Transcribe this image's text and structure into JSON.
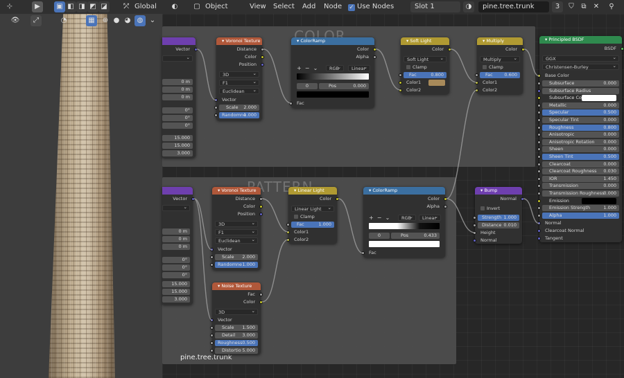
{
  "header": {
    "transform_orientation": "Global",
    "editor_type": "Object",
    "menu": [
      "View",
      "Select",
      "Add",
      "Node"
    ],
    "use_nodes_label": "Use Nodes",
    "use_nodes": true,
    "slot": "Slot 1",
    "material_name": "pine.tree.trunk",
    "user_count": "3"
  },
  "frames": {
    "color": "COLOR",
    "pattern": "PATTERN",
    "footer": "pine.tree.trunk"
  },
  "left_partial": {
    "top": {
      "vector": "Vector",
      "values": [
        "0 m",
        "0 m",
        "0 m",
        "0°",
        "0°",
        "0°",
        "15.000",
        "15.000",
        "3.000"
      ]
    },
    "bottom": {
      "vector": "Vector",
      "values": [
        "0 m",
        "0 m",
        "0 m",
        "0°",
        "0°",
        "0°",
        "15.000",
        "15.000",
        "3.000"
      ]
    }
  },
  "voronoi1": {
    "title": "Voronoi Texture",
    "out": [
      "Distance",
      "Color",
      "Position"
    ],
    "dims": "3D",
    "feature": "F1",
    "metric": "Euclidean",
    "vector": "Vector",
    "scale_label": "Scale",
    "scale": "2.000",
    "rand_label": "Randomne",
    "rand": "1.000"
  },
  "ramp1": {
    "title": "ColorRamp",
    "out": [
      "Color",
      "Alpha"
    ],
    "mode": "RGB",
    "interp": "Linear",
    "index": "0",
    "pos_label": "Pos",
    "pos": "0.000",
    "fac": "Fac"
  },
  "softlight": {
    "title": "Soft Light",
    "out": "Color",
    "blend": "Soft Light",
    "clamp": "Clamp",
    "fac_label": "Fac",
    "fac": "0.800",
    "color1": "Color1",
    "color2": "Color2",
    "swatch": "#a88a5a"
  },
  "multiply": {
    "title": "Multiply",
    "out": "Color",
    "blend": "Multiply",
    "clamp": "Clamp",
    "fac_label": "Fac",
    "fac": "0.600",
    "color1": "Color1",
    "color2": "Color2"
  },
  "bsdf": {
    "title": "Principled BSDF",
    "out": "BSDF",
    "dist": "GGX",
    "sss": "Christensen-Burley",
    "base_color": "Base Color",
    "rows": [
      {
        "l": "Subsurface",
        "v": "0.000"
      },
      {
        "l": "Subsurface Radius",
        "v": ""
      },
      {
        "l": "Subsurface Color",
        "v": ""
      },
      {
        "l": "Metallic",
        "v": "0.000"
      },
      {
        "l": "Specular",
        "v": "0.500"
      },
      {
        "l": "Specular Tint",
        "v": "0.000"
      },
      {
        "l": "Roughness",
        "v": "0.800"
      },
      {
        "l": "Anisotropic",
        "v": "0.000"
      },
      {
        "l": "Anisotropic Rotation",
        "v": "0.000"
      },
      {
        "l": "Sheen",
        "v": "0.000"
      },
      {
        "l": "Sheen Tint",
        "v": "0.500"
      },
      {
        "l": "Clearcoat",
        "v": "0.000"
      },
      {
        "l": "Clearcoat Roughness",
        "v": "0.030"
      },
      {
        "l": "IOR",
        "v": "1.450"
      },
      {
        "l": "Transmission",
        "v": "0.000"
      },
      {
        "l": "Transmission Roughness",
        "v": "0.000"
      },
      {
        "l": "Emission",
        "v": ""
      },
      {
        "l": "Emission Strength",
        "v": "1.000"
      },
      {
        "l": "Alpha",
        "v": "1.000"
      }
    ],
    "inputs": [
      "Normal",
      "Clearcoat Normal",
      "Tangent"
    ]
  },
  "voronoi2": {
    "title": "Voronoi Texture",
    "out": [
      "Distance",
      "Color",
      "Position"
    ],
    "dims": "3D",
    "feature": "F1",
    "metric": "Euclidean",
    "vector": "Vector",
    "scale_label": "Scale",
    "scale": "2.000",
    "rand_label": "Randomne",
    "rand": "1.000"
  },
  "linearlight": {
    "title": "Linear Light",
    "out": "Color",
    "blend": "Linear Light",
    "clamp": "Clamp",
    "fac_label": "Fac",
    "fac": "1.000",
    "color1": "Color1",
    "color2": "Color2"
  },
  "ramp2": {
    "title": "ColorRamp",
    "out": [
      "Color",
      "Alpha"
    ],
    "mode": "RGB",
    "interp": "Linear",
    "index": "0",
    "pos_label": "Pos",
    "pos": "0.433",
    "fac": "Fac"
  },
  "bump": {
    "title": "Bump",
    "out": "Normal",
    "invert": "Invert",
    "strength_label": "Strength",
    "strength": "1.000",
    "distance_label": "Distance",
    "distance": "0.010",
    "height": "Height",
    "normal": "Normal"
  },
  "noise": {
    "title": "Noise Texture",
    "out": [
      "Fac",
      "Color"
    ],
    "dims": "3D",
    "vector": "Vector",
    "scale_label": "Scale",
    "scale": "1.500",
    "detail_label": "Detail",
    "detail": "3.000",
    "rough_label": "Roughness",
    "rough": "0.500",
    "distort_label": "Distortio",
    "distort": "5.000"
  }
}
